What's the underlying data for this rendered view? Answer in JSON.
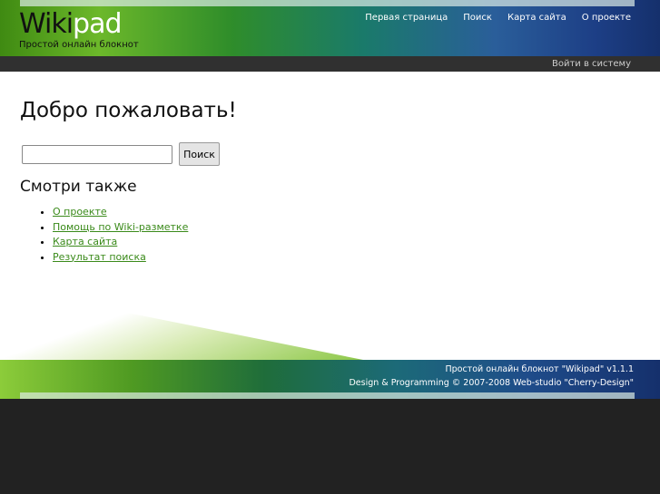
{
  "header": {
    "logo_dark": "Wiki",
    "logo_light": "pad",
    "tagline": "Простой онлайн блокнот",
    "nav": [
      "Первая страница",
      "Поиск",
      "Карта сайта",
      "О проекте"
    ],
    "login": "Войти в систему"
  },
  "main": {
    "title": "Добро пожаловать!",
    "search_value": "",
    "search_button": "Поиск",
    "see_also": "Смотри также",
    "links": [
      "О проекте",
      "Помощь по Wiki-разметке",
      "Карта сайта",
      "Результат поиска"
    ]
  },
  "footer": {
    "line1": "Простой онлайн блокнот \"Wikipad\" v1.1.1",
    "line2": "Design & Programming © 2007-2008 Web-studio \"Cherry-Design\""
  }
}
